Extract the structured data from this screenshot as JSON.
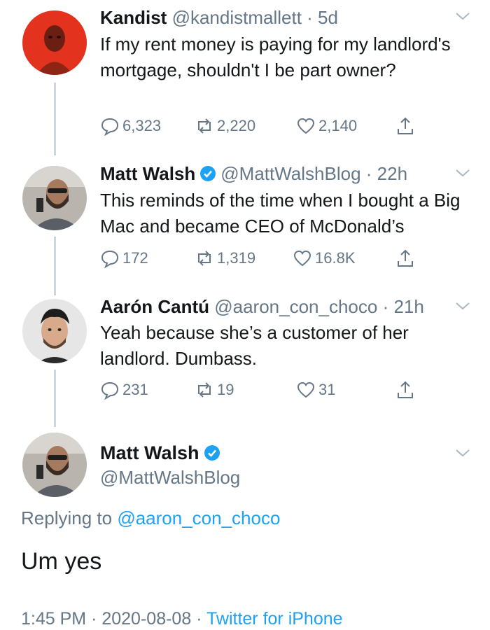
{
  "tweets": [
    {
      "name": "Kandist",
      "handle": "@kandistmallett",
      "time": "5d",
      "verified": false,
      "text": "If my rent money is paying for my landlord's mortgage, shouldn't I be part owner?",
      "replies": "6,323",
      "retweets": "2,220",
      "likes": "2,140"
    },
    {
      "name": "Matt Walsh",
      "handle": "@MattWalshBlog",
      "time": "22h",
      "verified": true,
      "text": "This reminds of the time when I bought a Big Mac and became CEO of McDonald’s",
      "replies": "172",
      "retweets": "1,319",
      "likes": "16.8K"
    },
    {
      "name": "Aarón Cantú",
      "handle": "@aaron_con_choco",
      "time": "21h",
      "verified": false,
      "text": "Yeah because she’s a customer of her landlord. Dumbass.",
      "replies": "231",
      "retweets": "19",
      "likes": "31"
    }
  ],
  "main_tweet": {
    "name": "Matt Walsh",
    "handle": "@MattWalshBlog",
    "verified": true,
    "replying_prefix": "Replying to ",
    "replying_to": "@aaron_con_choco",
    "text": "Um yes",
    "time": "1:45 PM",
    "date": "2020-08-08",
    "source": "Twitter for iPhone"
  },
  "separator": "·",
  "colors": {
    "text": "#14171a",
    "muted": "#657786",
    "accent": "#1da1f2",
    "thread_line": "#ccd6dd"
  },
  "icons": {
    "reply": "reply-icon",
    "retweet": "retweet-icon",
    "like": "heart-icon",
    "share": "share-icon",
    "verified": "verified-badge-icon",
    "more": "chevron-down-icon"
  }
}
